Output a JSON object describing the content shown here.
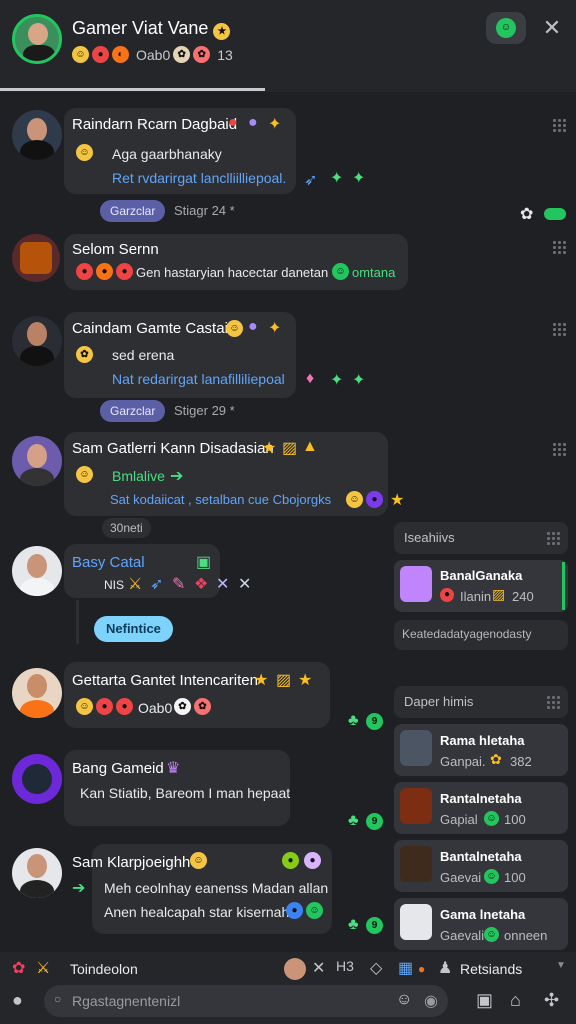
{
  "header": {
    "title": "Gamer Viat Vane",
    "sub_label": "Oab0",
    "count": "13"
  },
  "messages": [
    {
      "name": "Raindarn Rcarn Dagbaid",
      "lines": [
        "Aga gaarbhanaky",
        "Ret rvdarirgat lanclliilliepoal."
      ],
      "chip": "Garzclar",
      "timestamp": "Stiagr 24 *"
    },
    {
      "name": "Selom Sernn",
      "lines": [
        "Gen hastaryian hacectar danetan",
        "omtana"
      ]
    },
    {
      "name": "Caindam Gamte Castaid",
      "lines": [
        "sed erena",
        "Nat redarirgat lanafilliliepoal"
      ],
      "chip": "Garzclar",
      "timestamp": "Stiger 29 *"
    },
    {
      "name": "Sam Gatlerri Kann Disadasian",
      "lines": [
        "Bmlalive",
        "Sat kodaiicat , setalban cue Cbojorgks"
      ],
      "timestamp": "30neti"
    },
    {
      "name": "Basy Catal",
      "lines": [
        "NIS"
      ],
      "chip": "Nefintice"
    },
    {
      "name": "Gettarta Gantet Intencariten",
      "lines": [
        "Oab0"
      ]
    },
    {
      "name": "Bang Gameid",
      "lines": [
        "Kan Stiatib, Bareom I man hepaat"
      ]
    },
    {
      "name": "Sam Klarpjoeighh",
      "lines": [
        "Meh ceolnhay eanenss Madan allan",
        "Anen healcapah star kisernah"
      ]
    }
  ],
  "side": {
    "box1_title": "Iseahiivs",
    "box1_user": {
      "name": "BanalGanaka",
      "status": "Ilanin",
      "value": "240"
    },
    "box1_note": "Keatedadatyagenodasty",
    "box2_title": "Daper himis",
    "users": [
      {
        "name": "Rama hletaha",
        "status": "Ganpai.",
        "value": "382"
      },
      {
        "name": "Rantalnetaha",
        "status": "Gapial",
        "value": "100"
      },
      {
        "name": "Bantalnetaha",
        "status": "Gaevai",
        "value": "100"
      },
      {
        "name": "Gama lnetaha",
        "status": "Gaevali",
        "value": "onneen"
      }
    ]
  },
  "bottom": {
    "left_label": "Toindeolon",
    "right_label": "Retsiands",
    "search_placeholder": "Rgastagnentenizl"
  }
}
